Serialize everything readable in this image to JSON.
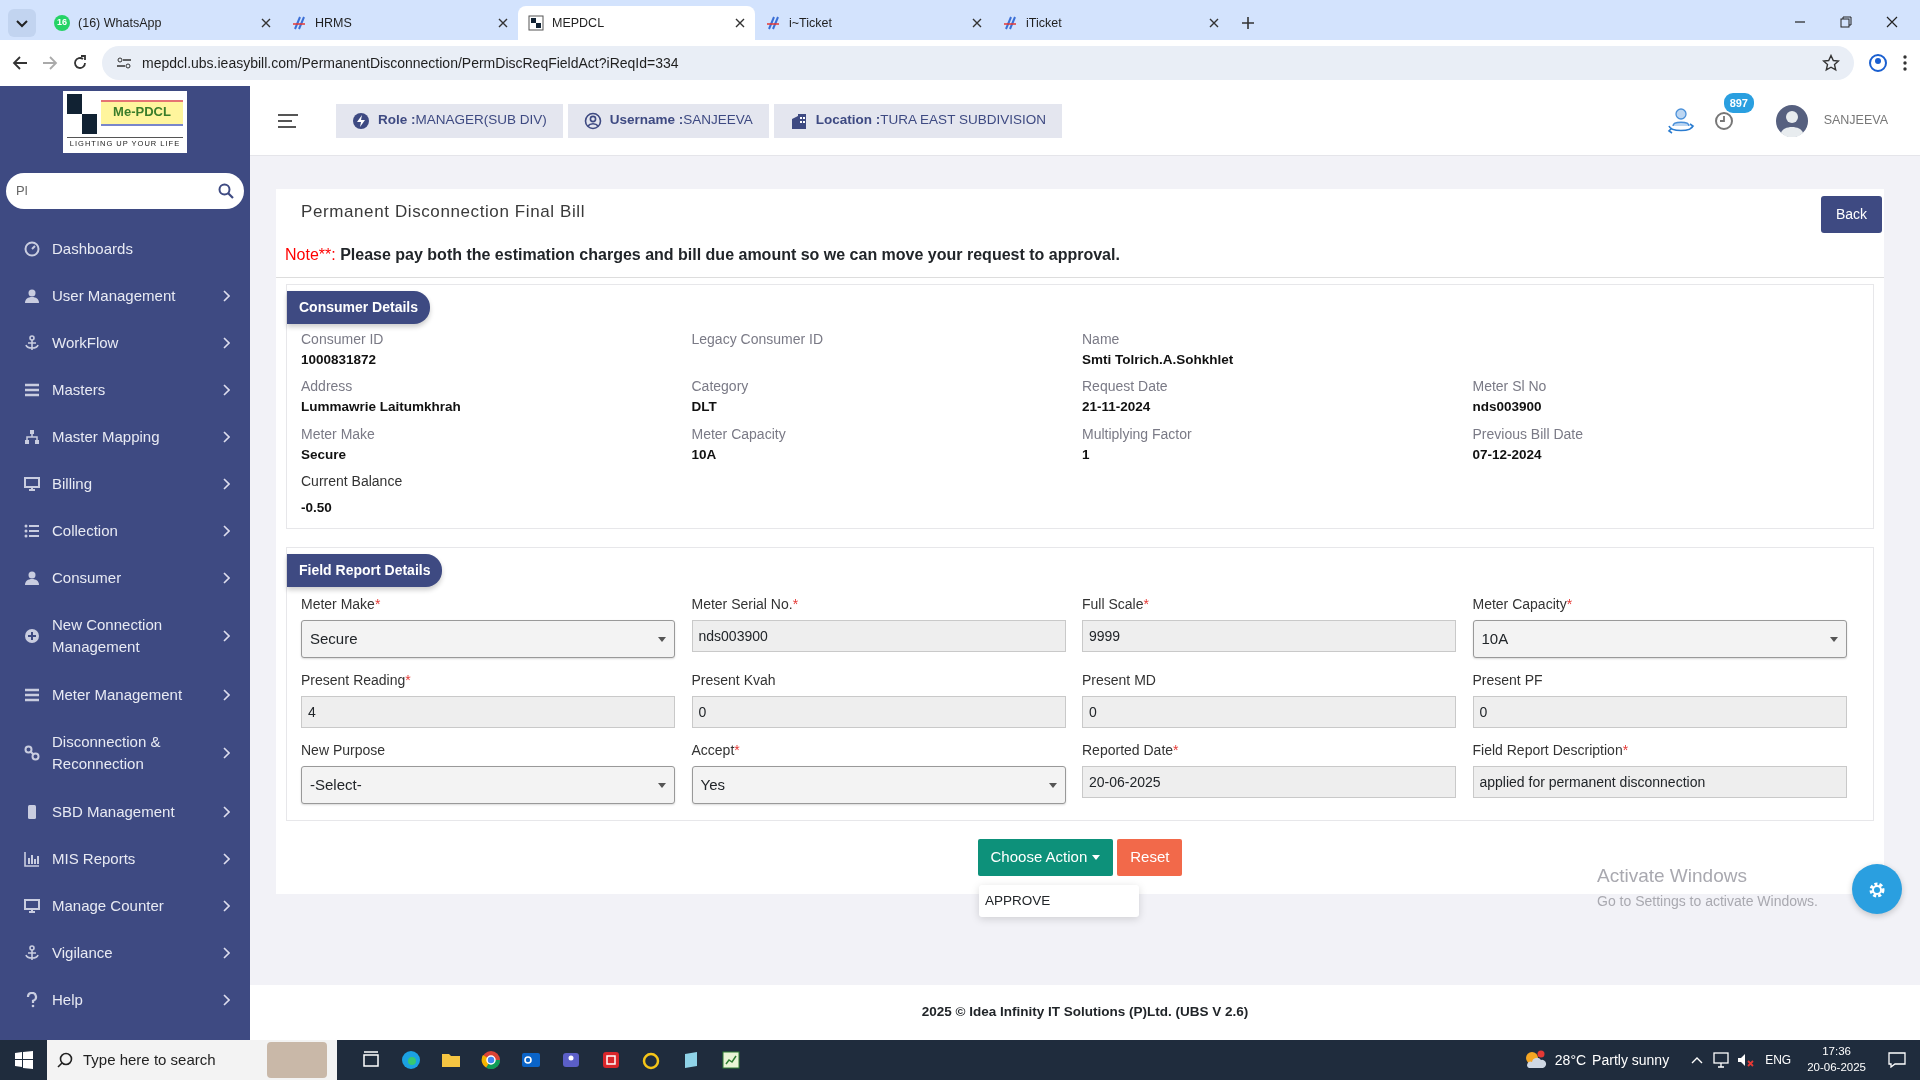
{
  "browser": {
    "tabs": [
      {
        "title": "(16) WhatsApp",
        "badge": "16",
        "selected": false
      },
      {
        "title": "HRMS",
        "selected": false
      },
      {
        "title": "MEPDCL",
        "selected": true
      },
      {
        "title": "i~Ticket",
        "selected": false
      },
      {
        "title": "iTicket",
        "selected": false
      }
    ],
    "url": "mepdcl.ubs.ieasybill.com/PermanentDisconnection/PermDiscReqFieldAct?iReqId=334"
  },
  "logo": {
    "name": "Me-PDCL",
    "tagline": "LIGHTING UP YOUR LIFE"
  },
  "sidebar": {
    "search": {
      "value": "Pl"
    },
    "items": [
      {
        "label": "Dashboards",
        "submenu": false
      },
      {
        "label": "User Management",
        "submenu": true
      },
      {
        "label": "WorkFlow",
        "submenu": true
      },
      {
        "label": "Masters",
        "submenu": true
      },
      {
        "label": "Master Mapping",
        "submenu": true
      },
      {
        "label": "Billing",
        "submenu": true
      },
      {
        "label": "Collection",
        "submenu": true
      },
      {
        "label": "Consumer",
        "submenu": true
      },
      {
        "label": "New Connection Management",
        "submenu": true
      },
      {
        "label": "Meter Management",
        "submenu": true
      },
      {
        "label": "Disconnection & Reconnection",
        "submenu": true
      },
      {
        "label": "SBD Management",
        "submenu": true
      },
      {
        "label": "MIS Reports",
        "submenu": true
      },
      {
        "label": "Manage Counter",
        "submenu": true
      },
      {
        "label": "Vigilance",
        "submenu": true
      },
      {
        "label": "Help",
        "submenu": true
      }
    ]
  },
  "header": {
    "chips": [
      "**Role :**MANAGER(SUB DIV)",
      "**Username :**SANJEEVA",
      "**Location :**TURA EAST SUBDIVISION"
    ],
    "notification_count": "897",
    "user": "SANJEEVA"
  },
  "page": {
    "title": "Permanent Disconnection Final Bill",
    "back": "Back",
    "note_label": "Note**:",
    "note": "Please pay both the estimation charges and bill due amount so we can move your request to approval.",
    "consumer_details": {
      "heading": "Consumer Details",
      "rows": [
        [
          {
            "label": "Consumer ID",
            "value": "1000831872"
          },
          {
            "label": "Legacy Consumer ID"
          },
          {
            "label": "Name",
            "value": "Smti Tolrich.A.Sohkhlet"
          }
        ],
        [
          {
            "label": "Address",
            "value": "Lummawrie Laitumkhrah"
          },
          {
            "label": "Category",
            "value": "DLT"
          },
          {
            "label": "Request Date",
            "value": "21-11-2024"
          },
          {
            "label": "Meter Sl No",
            "value": "nds003900"
          }
        ],
        [
          {
            "label": "Meter Make",
            "value": "Secure"
          },
          {
            "label": "Meter Capacity",
            "value": "10A"
          },
          {
            "label": "Multiplying Factor",
            "value": "1"
          },
          {
            "label": "Previous Bill Date",
            "value": "07-12-2024"
          }
        ],
        [
          {
            "label": "Current Balance",
            "value": "-0.50"
          }
        ]
      ]
    },
    "field_report": {
      "heading": "Field Report Details",
      "fields": [
        {
          "label": "Meter Make",
          "required_mark": "*",
          "kind": "select",
          "value": "Secure"
        },
        {
          "label": "Meter Serial No.",
          "required_mark": "*",
          "kind": "input",
          "value": "nds003900"
        },
        {
          "label": "Full Scale",
          "required_mark": "*",
          "kind": "input",
          "value": "9999"
        },
        {
          "label": "Meter Capacity",
          "required_mark": "*",
          "kind": "select",
          "value": "10A"
        },
        {
          "label": "Present Reading",
          "required_mark": "*",
          "kind": "input",
          "value": "4"
        },
        {
          "label": "Present Kvah",
          "kind": "input",
          "value": "0"
        },
        {
          "label": "Present MD",
          "kind": "input",
          "value": "0"
        },
        {
          "label": "Present PF",
          "kind": "input",
          "value": "0"
        },
        {
          "label": "New Purpose",
          "kind": "select",
          "value": "-Select-"
        },
        {
          "label": "Accept",
          "required_mark": "*",
          "kind": "select",
          "value": "Yes"
        },
        {
          "label": "Reported Date",
          "required_mark": "*",
          "kind": "input",
          "value": "20-06-2025"
        },
        {
          "label": "Field Report Description",
          "required_mark": "*",
          "kind": "input",
          "value": "applied for permanent disconnection"
        }
      ]
    },
    "actions": {
      "choose": "Choose Action",
      "reset": "Reset",
      "menu_open": true,
      "menu": [
        "APPROVE"
      ]
    }
  },
  "footer": "2025 © Idea Infinity IT Solutions (P)Ltd. (UBS V 2.6)",
  "activation": {
    "title": "Activate Windows",
    "hint": "Go to Settings to activate Windows."
  },
  "taskbar": {
    "search_placeholder": "Type here to search",
    "temperature": "28°C",
    "weather": "Partly sunny",
    "language": "ENG",
    "time": "17:36",
    "date": "20-06-2025"
  }
}
